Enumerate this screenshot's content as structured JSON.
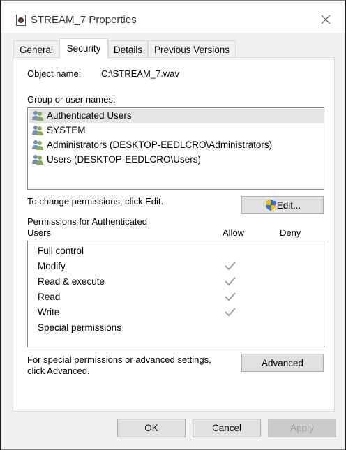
{
  "window": {
    "title": "STREAM_7 Properties"
  },
  "tabs": [
    {
      "label": "General",
      "active": false
    },
    {
      "label": "Security",
      "active": true
    },
    {
      "label": "Details",
      "active": false
    },
    {
      "label": "Previous Versions",
      "active": false
    }
  ],
  "object": {
    "label": "Object name:",
    "value": "C:\\STREAM_7.wav"
  },
  "groups": {
    "label": "Group or user names:",
    "items": [
      "Authenticated Users",
      "SYSTEM",
      "Administrators (DESKTOP-EEDLCRO\\Administrators)",
      "Users (DESKTOP-EEDLCRO\\Users)"
    ],
    "selected_index": 0
  },
  "change_text": "To change permissions, click Edit.",
  "edit_button": "Edit...",
  "permissions": {
    "label_line1": "Permissions for Authenticated",
    "label_line2": "Users",
    "allow_header": "Allow",
    "deny_header": "Deny",
    "rows": [
      {
        "name": "Full control",
        "allow": false,
        "deny": false
      },
      {
        "name": "Modify",
        "allow": true,
        "deny": false
      },
      {
        "name": "Read & execute",
        "allow": true,
        "deny": false
      },
      {
        "name": "Read",
        "allow": true,
        "deny": false
      },
      {
        "name": "Write",
        "allow": true,
        "deny": false
      },
      {
        "name": "Special permissions",
        "allow": false,
        "deny": false
      }
    ]
  },
  "advanced": {
    "text_line1": "For special permissions or advanced settings,",
    "text_line2": "click Advanced.",
    "button": "Advanced"
  },
  "footer": {
    "ok": "OK",
    "cancel": "Cancel",
    "apply": "Apply"
  },
  "colors": {
    "window_bg": "#f0f0f0",
    "panel_bg": "#ffffff",
    "selected_row": "#e5e5e5",
    "check_gray": "#a0a0a0"
  }
}
